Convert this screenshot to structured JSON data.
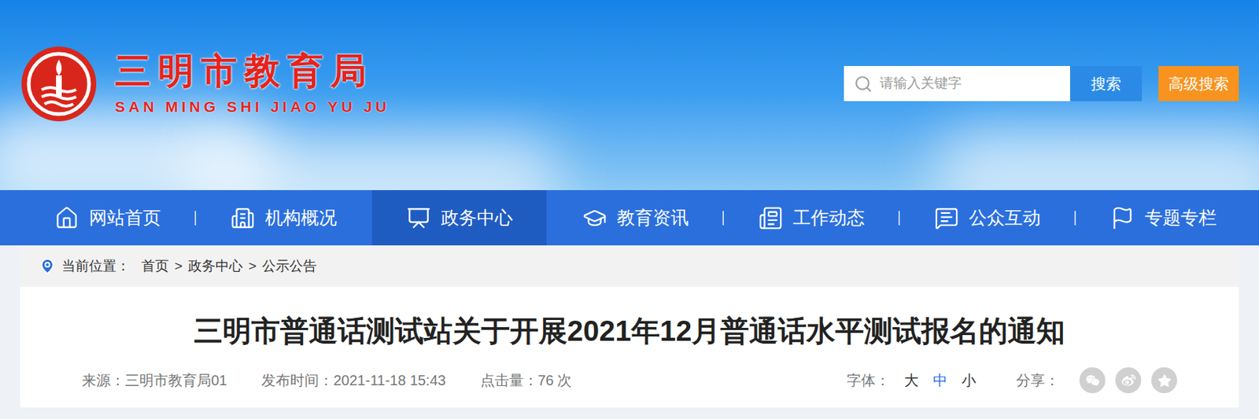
{
  "site": {
    "title": "三明市教育局",
    "subtitle": "SAN MING SHI JIAO YU JU"
  },
  "search": {
    "placeholder": "请输入关键字",
    "button": "搜索",
    "advanced": "高级搜索"
  },
  "nav": [
    {
      "label": "网站首页",
      "selected": false
    },
    {
      "label": "机构概况",
      "selected": false
    },
    {
      "label": "政务中心",
      "selected": true
    },
    {
      "label": "教育资讯",
      "selected": false
    },
    {
      "label": "工作动态",
      "selected": false
    },
    {
      "label": "公众互动",
      "selected": false
    },
    {
      "label": "专题专栏",
      "selected": false
    }
  ],
  "breadcrumb": {
    "label": "当前位置：",
    "items": [
      "首页",
      "政务中心",
      "公示公告"
    ],
    "separator": ">"
  },
  "article": {
    "title": "三明市普通话测试站关于开展2021年12月普通话水平测试报名的通知",
    "meta": [
      {
        "label": "来源：",
        "value": "三明市教育局01"
      },
      {
        "label": "发布时间：",
        "value": "2021-11-18 15:43"
      },
      {
        "label": "点击量：",
        "value": "76 次"
      }
    ],
    "font": {
      "label": "字体：",
      "sizes": [
        {
          "label": "大",
          "selected": false
        },
        {
          "label": "中",
          "selected": true
        },
        {
          "label": "小",
          "selected": false
        }
      ]
    },
    "share": {
      "label": "分享："
    }
  }
}
